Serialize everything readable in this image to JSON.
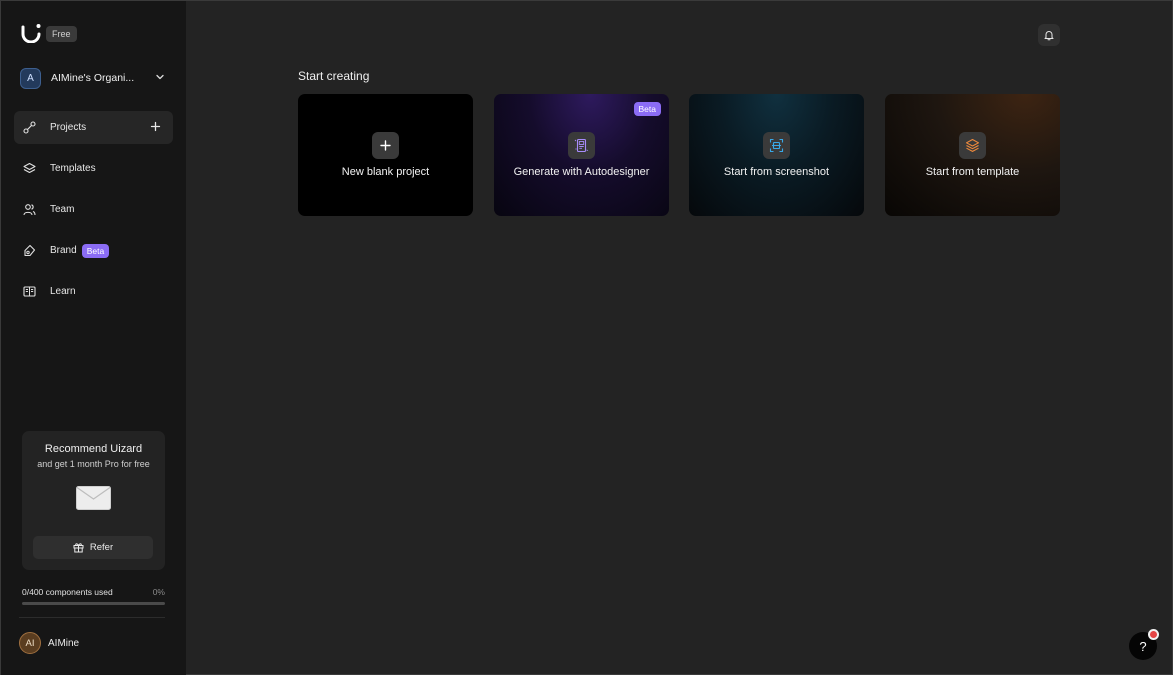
{
  "sidebar": {
    "plan_badge": "Free",
    "org": {
      "avatar_initial": "A",
      "name": "AIMine's Organi..."
    },
    "items": [
      {
        "label": "Projects",
        "icon": "projects-icon"
      },
      {
        "label": "Templates",
        "icon": "layers-icon"
      },
      {
        "label": "Team",
        "icon": "team-icon"
      },
      {
        "label": "Brand",
        "icon": "brand-icon",
        "badge": "Beta"
      },
      {
        "label": "Learn",
        "icon": "book-icon"
      }
    ],
    "recommend": {
      "title": "Recommend Uizard",
      "subtitle": "and get 1 month Pro for free",
      "refer_label": "Refer"
    },
    "usage": {
      "label": "0/400 components used",
      "percent_label": "0%",
      "fraction": 0
    },
    "user": {
      "initials": "AI",
      "name": "AIMine"
    }
  },
  "main": {
    "section_title": "Start creating",
    "cards": [
      {
        "label": "New blank project",
        "icon": "plus-icon"
      },
      {
        "label": "Generate with Autodesigner",
        "icon": "autodesigner-icon",
        "badge": "Beta"
      },
      {
        "label": "Start from screenshot",
        "icon": "screenshot-icon"
      },
      {
        "label": "Start from template",
        "icon": "layers-icon"
      }
    ]
  },
  "help": {
    "label": "?"
  },
  "colors": {
    "accent_beta": "#8b6cf5",
    "autodesigner_icon": "#a78bfa",
    "screenshot_icon": "#38a8e8",
    "template_icon": "#f08a3c",
    "notification_dot": "#e64545"
  }
}
